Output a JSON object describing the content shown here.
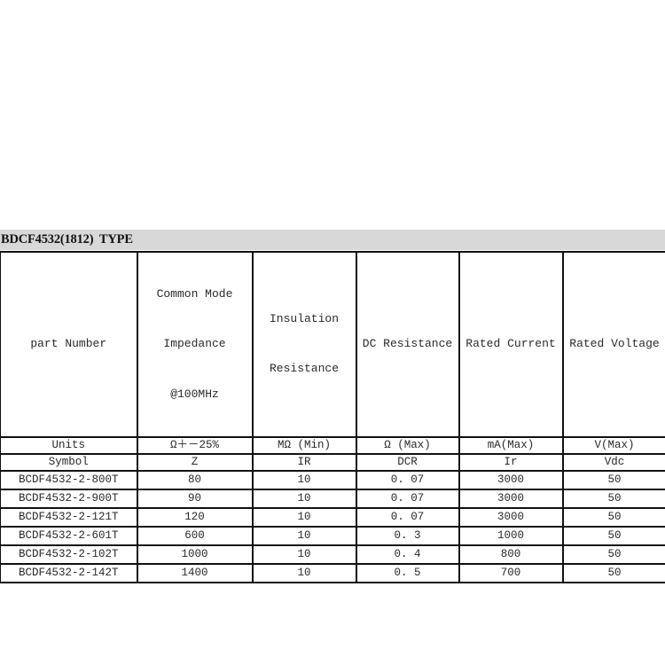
{
  "document": {
    "title_band": {
      "text": "BDCF4532(1812)  TYPE",
      "background_color": "#d8d8d8"
    }
  },
  "table": {
    "columns": [
      {
        "key": "part_number",
        "header_lines": [
          "part Number"
        ]
      },
      {
        "key": "impedance",
        "header_lines": [
          "Common Mode",
          "Impedance",
          "@100MHz"
        ]
      },
      {
        "key": "insulation",
        "header_lines": [
          "Insulation",
          "Resistance"
        ]
      },
      {
        "key": "dc_resistance",
        "header_lines": [
          "DC Resistance"
        ]
      },
      {
        "key": "rated_current",
        "header_lines": [
          "Rated Current"
        ]
      },
      {
        "key": "rated_voltage",
        "header_lines": [
          "Rated Voltage"
        ]
      }
    ],
    "units_row": {
      "label": "Units",
      "values": [
        "Ω＋－25%",
        "MΩ (Min)",
        "Ω (Max)",
        "mA(Max)",
        "V(Max)"
      ]
    },
    "symbol_row": {
      "label": "Symbol",
      "values": [
        "Z",
        "IR",
        "DCR",
        "Ir",
        "Vdc"
      ]
    },
    "rows": [
      {
        "part_number": "BCDF4532-2-800T",
        "impedance": "80",
        "insulation": "10",
        "dc_resistance": "0. 07",
        "rated_current": "3000",
        "rated_voltage": "50"
      },
      {
        "part_number": "BCDF4532-2-900T",
        "impedance": "90",
        "insulation": "10",
        "dc_resistance": "0. 07",
        "rated_current": "3000",
        "rated_voltage": "50"
      },
      {
        "part_number": "BCDF4532-2-121T",
        "impedance": "120",
        "insulation": "10",
        "dc_resistance": "0. 07",
        "rated_current": "3000",
        "rated_voltage": "50"
      },
      {
        "part_number": "BCDF4532-2-601T",
        "impedance": "600",
        "insulation": "10",
        "dc_resistance": "0. 3",
        "rated_current": "1000",
        "rated_voltage": "50"
      },
      {
        "part_number": "BCDF4532-2-102T",
        "impedance": "1000",
        "insulation": "10",
        "dc_resistance": "0. 4",
        "rated_current": "800",
        "rated_voltage": "50"
      },
      {
        "part_number": "BCDF4532-2-142T",
        "impedance": "1400",
        "insulation": "10",
        "dc_resistance": "0. 5",
        "rated_current": "700",
        "rated_voltage": "50"
      }
    ]
  }
}
